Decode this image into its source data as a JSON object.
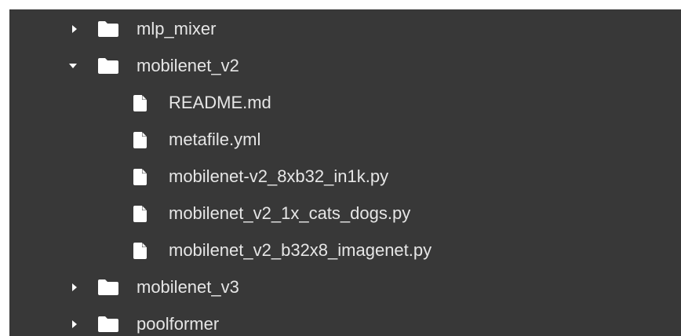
{
  "file_tree": {
    "items": [
      {
        "name": "mlp_mixer",
        "type": "folder",
        "expanded": false,
        "icon": "folder-icon"
      },
      {
        "name": "mobilenet_v2",
        "type": "folder",
        "expanded": true,
        "icon": "folder-icon"
      },
      {
        "name": "README.md",
        "type": "file",
        "icon": "file-icon"
      },
      {
        "name": "metafile.yml",
        "type": "file",
        "icon": "file-icon"
      },
      {
        "name": "mobilenet-v2_8xb32_in1k.py",
        "type": "file",
        "icon": "file-icon"
      },
      {
        "name": "mobilenet_v2_1x_cats_dogs.py",
        "type": "file",
        "icon": "file-icon"
      },
      {
        "name": "mobilenet_v2_b32x8_imagenet.py",
        "type": "file",
        "icon": "file-icon"
      },
      {
        "name": "mobilenet_v3",
        "type": "folder",
        "expanded": false,
        "icon": "folder-icon"
      },
      {
        "name": "poolformer",
        "type": "folder",
        "expanded": false,
        "icon": "folder-icon"
      }
    ]
  },
  "colors": {
    "panel_background": "#383838",
    "text": "#e6e6e6",
    "icon": "#ffffff"
  }
}
